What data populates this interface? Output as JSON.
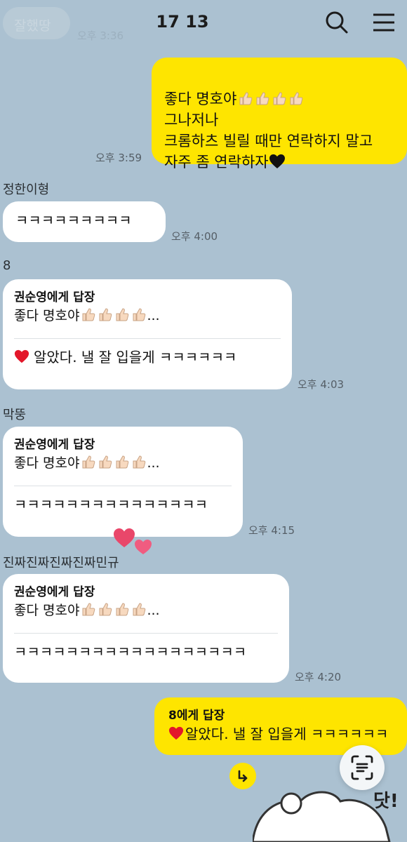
{
  "header": {
    "back_label": "잘했땅",
    "faded_time": "오후 3:36",
    "title": "17 13"
  },
  "messages": {
    "m1": {
      "lines": "좋다 명호야\n그나저나\n크롬하츠 빌릴 때만 연락하지 말고\n자주 좀 연락하자",
      "time": "오후 3:59"
    },
    "m2": {
      "sender": "정한이형",
      "text": "ㅋㅋㅋㅋㅋㅋㅋㅋㅋ",
      "time": "오후 4:00"
    },
    "m3": {
      "sender": "8",
      "reply_to": "권순영에게 답장",
      "quote": "좋다 명호야",
      "ellipsis": "...",
      "text": "알았다. 낼 잘 입을게 ㅋㅋㅋㅋㅋㅋ",
      "time": "오후 4:03"
    },
    "m4": {
      "sender": "막뚱",
      "reply_to": "권순영에게 답장",
      "quote": "좋다 명호야",
      "ellipsis": "...",
      "text": "ㅋㅋㅋㅋㅋㅋㅋㅋㅋㅋㅋㅋㅋㅋㅋ",
      "time": "오후 4:15"
    },
    "m5": {
      "sender": "진짜진짜진짜진짜민규",
      "reply_to": "권순영에게 답장",
      "quote": "좋다 명호야",
      "ellipsis": "...",
      "text": "ㅋㅋㅋㅋㅋㅋㅋㅋㅋㅋㅋㅋㅋㅋㅋㅋㅋㅋ",
      "time": "오후 4:20"
    },
    "m6": {
      "reply_to": "8에게 답장",
      "text": "알았다. 낼 잘 입을게 ㅋㅋㅋㅋㅋㅋ"
    }
  },
  "sticker_text": "닷!",
  "icons": [
    "search-icon",
    "menu-icon",
    "thumbs-up-icon",
    "black-heart-icon",
    "red-heart-icon",
    "scroll-down-icon",
    "text-scan-icon"
  ],
  "colors": {
    "background": "#abc1d1",
    "my_bubble": "#fee500",
    "other_bubble": "#ffffff"
  }
}
